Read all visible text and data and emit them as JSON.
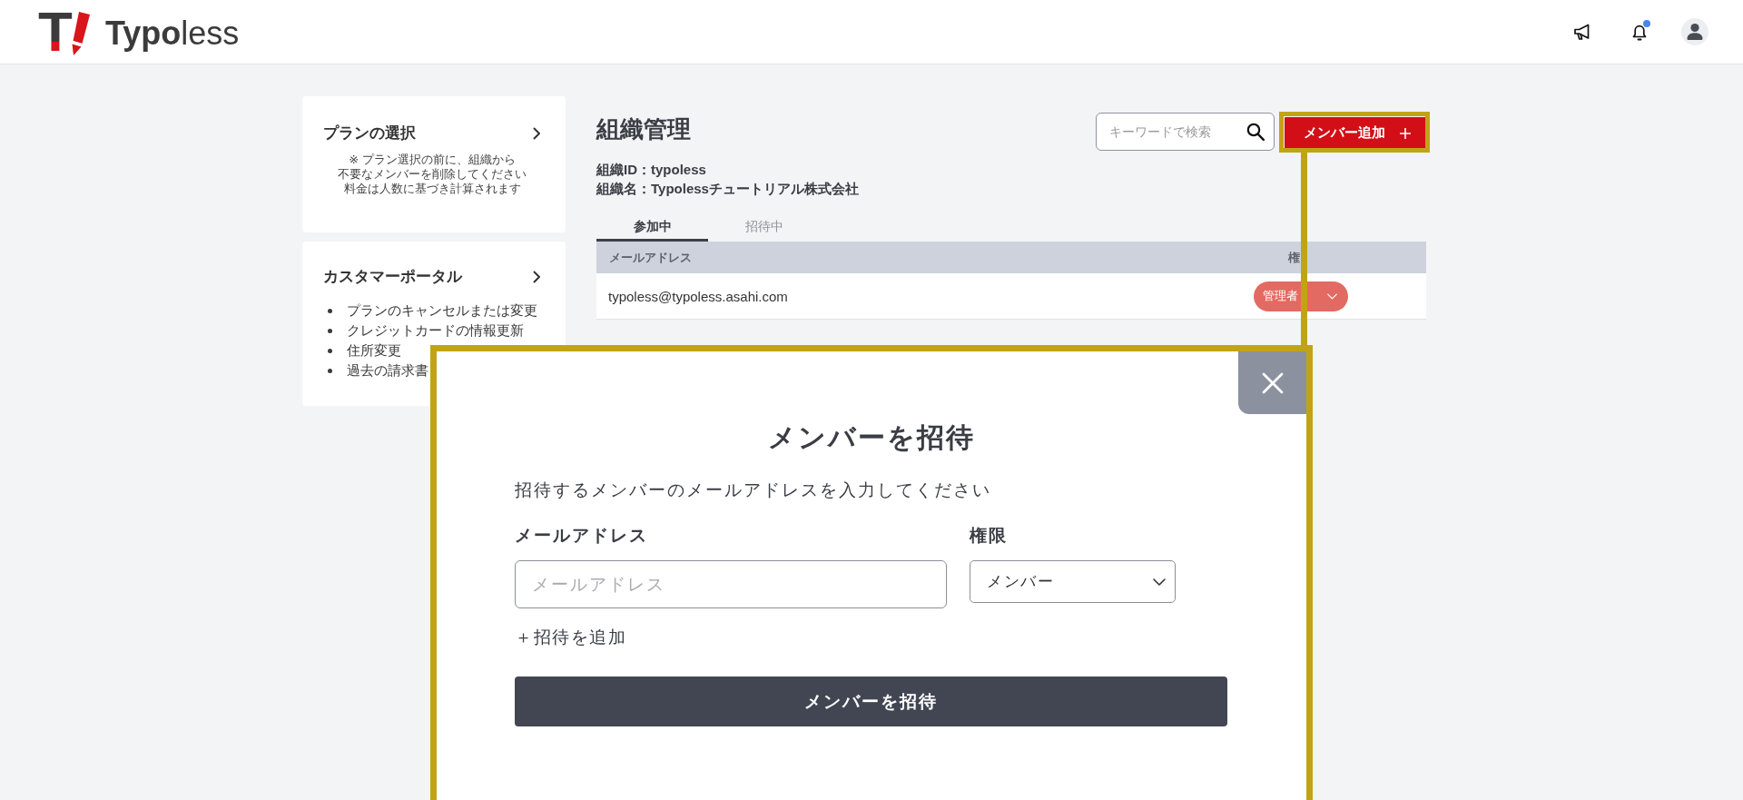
{
  "header": {
    "logo": {
      "mark": "T",
      "name": "**Typo**less"
    },
    "notifications": {
      "unread": true
    }
  },
  "sidebar": {
    "cards": [
      {
        "kind": "note",
        "title": "プランの選択",
        "lines": [
          "※ プラン選択の前に、組織から",
          "不要なメンバーを削除してください",
          "料金は人数に基づき計算されます"
        ]
      },
      {
        "kind": "list",
        "title": "カスタマーポータル",
        "items": [
          "プランのキャンセルまたは変更",
          "クレジットカードの情報更新",
          "住所変更",
          "過去の請求書"
        ]
      }
    ]
  },
  "organization": {
    "title": "組織管理",
    "search": {
      "placeholder": "キーワードで検索"
    },
    "add_button": {
      "label": "メンバー追加"
    },
    "info": [
      "組織ID：typoless",
      "組織名：Typolessチュートリアル株式会社"
    ],
    "tabs": [
      {
        "label": "参加中",
        "selected": true
      },
      {
        "label": "招待中",
        "selected": false
      }
    ],
    "table": {
      "columns": [
        "メールアドレス",
        "権"
      ],
      "rows": [
        {
          "email": "typoless@typoless.asahi.com",
          "role": "管理者"
        }
      ]
    }
  },
  "modal": {
    "title": "メンバーを招待",
    "description": "招待するメンバーのメールアドレスを入力してください",
    "email": {
      "label": "メールアドレス",
      "placeholder": "メールアドレス"
    },
    "role": {
      "label": "権限",
      "value": "メンバー"
    },
    "add_link": "＋招待を追加",
    "submit": "メンバーを招待"
  }
}
